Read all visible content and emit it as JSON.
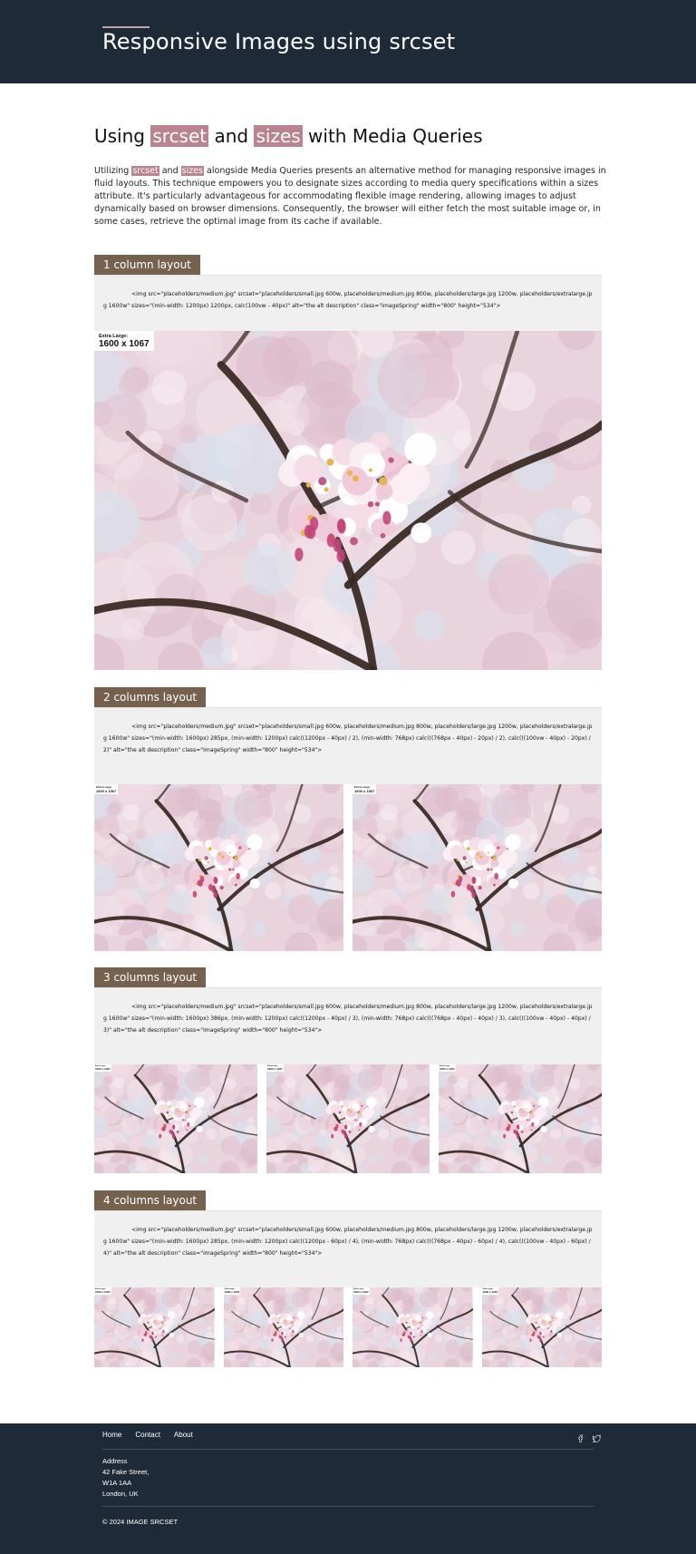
{
  "header": {
    "title": "Responsive Images using srcset"
  },
  "main": {
    "heading": {
      "pre": "Using",
      "code1": "srcset",
      "mid": "and",
      "code2": "sizes",
      "post": "with Media Queries"
    },
    "intro": {
      "pre": "Utilizing",
      "code1": "srcset",
      "mid": "and",
      "code2": "sizes",
      "post": "alongside Media Queries presents an alternative method for managing responsive images in fluid layouts. This technique empowers you to designate sizes according to media query specifications within a sizes attribute. It's particularly advantageous for accommodating flexible image rendering, allowing images to adjust dynamically based on browser dimensions. Consequently, the browser will either fetch the most suitable image or, in some cases, retrieve the optimal image from its cache if available."
    },
    "image_label": {
      "size_name": "Extra Large:",
      "dimensions": "1600 x 1067"
    },
    "sections": [
      {
        "title": "1 column layout",
        "code": "<img src=\"placeholders/medium.jpg\" srcset=\"placeholders/small.jpg 600w, placeholders/medium.jpg 800w, placeholders/large.jpg 1200w, placeholders/extralarge.jpg 1600w\" sizes=\"(min-width: 1200px) 1200px, calc(100vw - 40px)\" alt=\"the alt description\" class=\"imageSpring\" width=\"800\" height=\"534\">"
      },
      {
        "title": "2 columns layout",
        "code": "<img src=\"placeholders/medium.jpg\" srcset=\"placeholders/small.jpg 600w, placeholders/medium.jpg 800w, placeholders/large.jpg 1200w, placeholders/extralarge.jpg 1600w\" sizes=\"(min-width: 1600px) 285px, (min-width: 1200px) calc((1200px - 40px) / 2), (min-width: 768px) calc(((768px - 40px) - 20px) / 2), calc(((100vw - 40px) - 20px) / 2)\" alt=\"the alt description\" class=\"imageSpring\" width=\"800\" height=\"534\">"
      },
      {
        "title": "3 columns layout",
        "code": "<img src=\"placeholders/medium.jpg\" srcset=\"placeholders/small.jpg 600w, placeholders/medium.jpg 800w, placeholders/large.jpg 1200w, placeholders/extralarge.jpg 1600w\" sizes=\"(min-width: 1600px) 386px, (min-width: 1200px) calc((1200px - 40px) / 3), (min-width: 768px) calc(((768px - 40px) - 40px) / 3), calc(((100vw - 40px) - 40px) / 3)\" alt=\"the alt description\" class=\"imageSpring\" width=\"800\" height=\"534\">"
      },
      {
        "title": "4 columns layout",
        "code": "<img src=\"placeholders/medium.jpg\" srcset=\"placeholders/small.jpg 600w, placeholders/medium.jpg 800w, placeholders/large.jpg 1200w, placeholders/extralarge.jpg 1600w\" sizes=\"(min-width: 1600px) 285px, (min-width: 1200px) calc((1200px - 60px) / 4), (min-width: 768px) calc(((768px - 40px) - 60px) / 4), calc(((100vw - 40px) - 60px) / 4)\" alt=\"the alt description\" class=\"imageSpring\" width=\"800\" height=\"534\">"
      }
    ]
  },
  "footer": {
    "nav": [
      "Home",
      "Contact",
      "About"
    ],
    "social_icons": [
      "facebook-icon",
      "twitter-icon"
    ],
    "address": [
      "Address",
      "42 Fake Street,",
      "W1A 1AA",
      "London, UK"
    ],
    "copyright": "© 2024 IMAGE SRCSET"
  },
  "colors": {
    "header_bg": "#1e2a37",
    "highlight": "#b9838f",
    "tag_bg": "#75614d",
    "code_bg": "#f0f0f0"
  }
}
